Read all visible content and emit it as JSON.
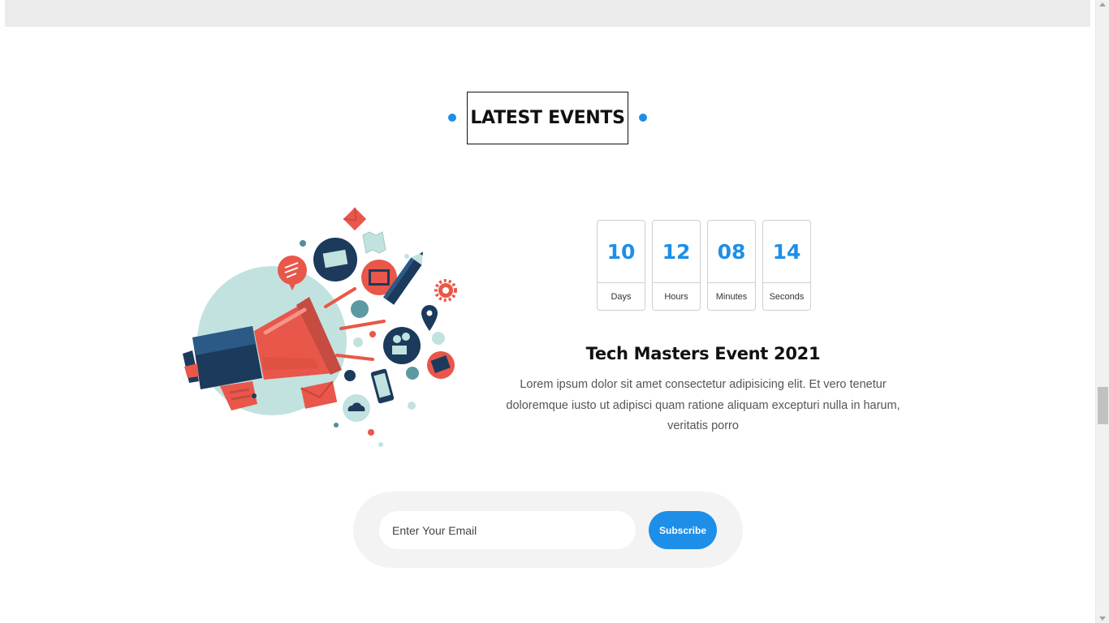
{
  "section": {
    "title": "LATEST EVENTS"
  },
  "countdown": [
    {
      "value": "10",
      "label": "Days"
    },
    {
      "value": "12",
      "label": "Hours"
    },
    {
      "value": "08",
      "label": "Minutes"
    },
    {
      "value": "14",
      "label": "Seconds"
    }
  ],
  "event": {
    "title": "Tech Masters Event 2021",
    "description": "Lorem ipsum dolor sit amet consectetur adipisicing elit. Et vero tenetur doloremque iusto ut adipisci quam ratione aliquam excepturi nulla in harum, veritatis porro"
  },
  "newsletter": {
    "email_placeholder": "Enter Your Email",
    "button_label": "Subscribe"
  },
  "illustration": {
    "icon": "megaphone-marketing-icon"
  },
  "colors": {
    "accent": "#1e8fe8",
    "coral": "#e8574a",
    "navy": "#1b3a5c",
    "mint": "#c2e2df"
  }
}
